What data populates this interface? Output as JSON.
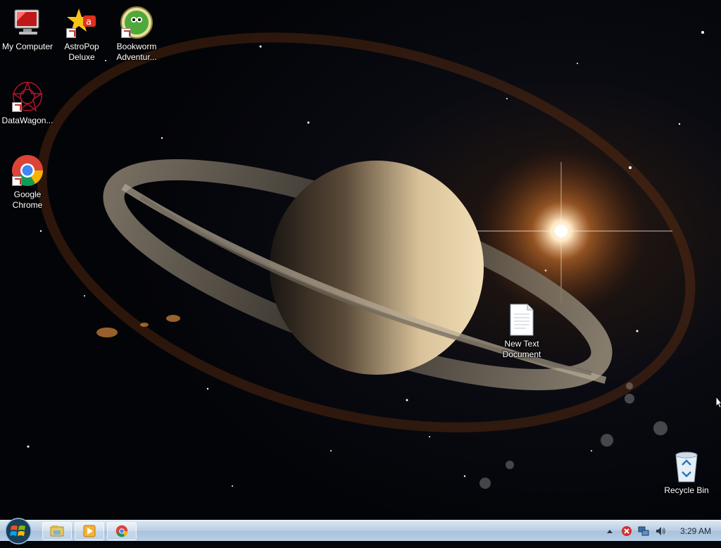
{
  "desktop": {
    "icons": [
      {
        "label": "My Computer"
      },
      {
        "label": "AstroPop\nDeluxe"
      },
      {
        "label": "Bookworm\nAdventur..."
      },
      {
        "label": "DataWagon..."
      },
      {
        "label": "Google\nChrome"
      },
      {
        "label": "New Text\nDocument"
      },
      {
        "label": "Recycle Bin"
      }
    ]
  },
  "taskbar": {
    "pinned": [
      "start-orb-icon",
      "file-explorer-icon",
      "media-player-icon",
      "chrome-icon"
    ],
    "tray_icons": [
      "show-hidden-icons-icon",
      "security-alert-icon",
      "network-icon",
      "volume-icon"
    ],
    "clock": "3:29 AM"
  },
  "colors": {
    "taskbar": "#b9cde2",
    "wallpaper": "#05060a",
    "label_text": "#ffffff"
  }
}
